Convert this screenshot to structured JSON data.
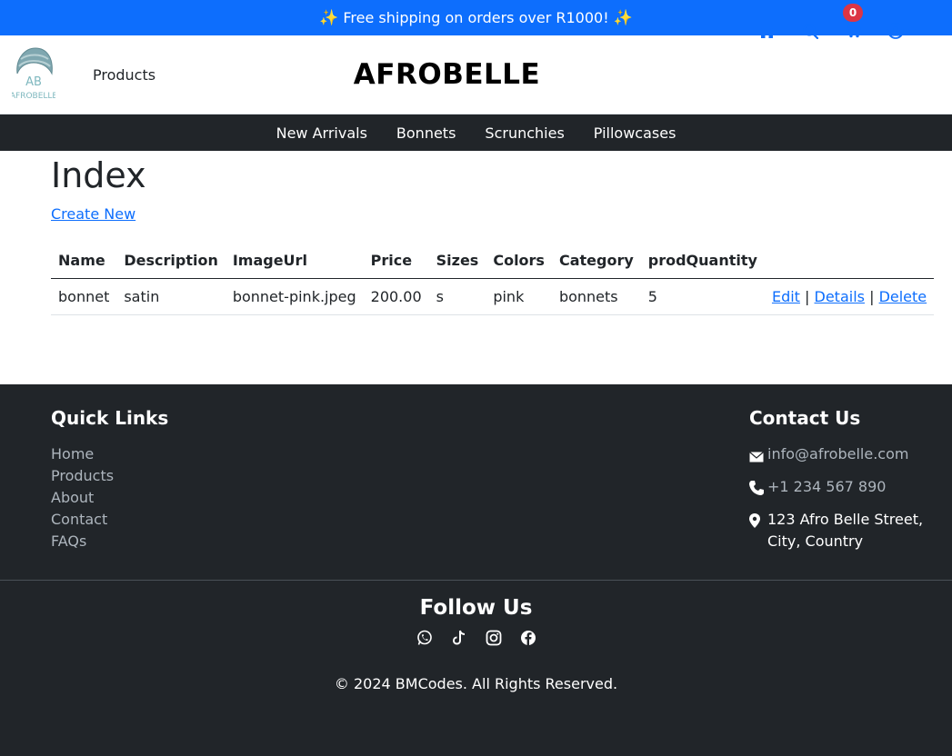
{
  "promo": {
    "text": "Free shipping on orders over R1000!",
    "sparkle": "✨"
  },
  "header": {
    "logo_text": "AB",
    "logo_subtext": "AFROBELLE",
    "products_link": "Products",
    "brand": "AFROBELLE",
    "cart_count": "0",
    "icons": [
      "home-icon",
      "search-icon",
      "cart-icon",
      "user-icon"
    ]
  },
  "category_nav": {
    "items": [
      {
        "label": "New Arrivals"
      },
      {
        "label": "Bonnets"
      },
      {
        "label": "Scrunchies"
      },
      {
        "label": "Pillowcases"
      }
    ]
  },
  "main": {
    "title": "Index",
    "create_link": "Create New",
    "table": {
      "headers": [
        "Name",
        "Description",
        "ImageUrl",
        "Price",
        "Sizes",
        "Colors",
        "Category",
        "prodQuantity",
        ""
      ],
      "rows": [
        {
          "name": "bonnet",
          "description": "satin",
          "image_url": "bonnet-pink.jpeg",
          "price": "200.00",
          "sizes": "s",
          "colors": "pink",
          "category": "bonnets",
          "quantity": "5",
          "edit": "Edit",
          "details": "Details",
          "delete": "Delete",
          "sep": "|"
        }
      ]
    }
  },
  "footer": {
    "quick_links_title": "Quick Links",
    "quick_links": [
      "Home",
      "Products",
      "About",
      "Contact",
      "FAQs"
    ],
    "contact_title": "Contact Us",
    "email": "info@afrobelle.com",
    "phone": "+1 234 567 890",
    "address": "123 Afro Belle Street, City, Country",
    "follow_title": "Follow Us",
    "socials": [
      "whatsapp-icon",
      "tiktok-icon",
      "instagram-icon",
      "facebook-icon"
    ],
    "copyright": "© 2024 BMCodes. All Rights Reserved."
  },
  "colors": {
    "primary": "#0d6efd",
    "dark": "#212529",
    "badge": "#dc3545",
    "muted": "#adb5bd"
  }
}
